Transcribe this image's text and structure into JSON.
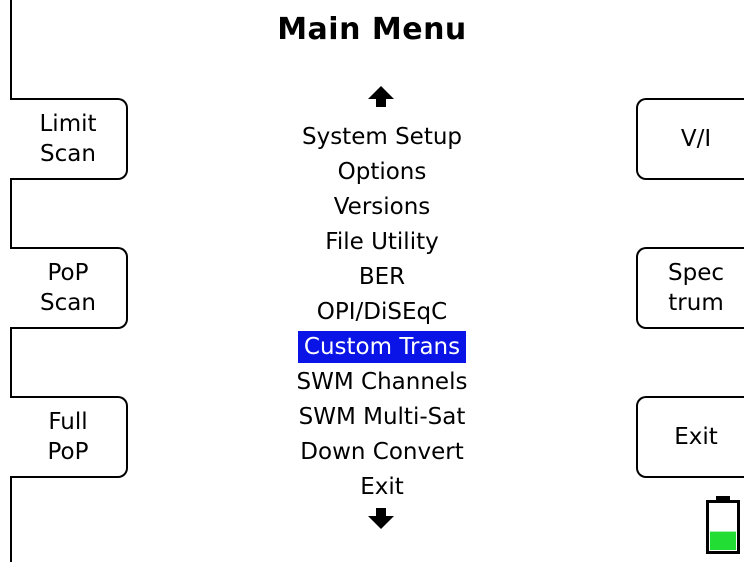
{
  "title": "Main Menu",
  "softkeys": {
    "left": [
      {
        "label": "Limit\nScan"
      },
      {
        "label": "PoP\nScan"
      },
      {
        "label": "Full\nPoP"
      }
    ],
    "right": [
      {
        "label": "V/I"
      },
      {
        "label": "Spec\ntrum"
      },
      {
        "label": "Exit"
      }
    ]
  },
  "menu": {
    "items": [
      "System Setup",
      "Options",
      "Versions",
      "File Utility",
      "BER",
      "OPI/DiSEqC",
      "Custom Trans",
      "SWM Channels",
      "SWM Multi-Sat",
      "Down Convert",
      "Exit"
    ],
    "selected": "Custom Trans",
    "scroll_up_icon": "arrow-up-icon",
    "scroll_down_icon": "arrow-down-icon"
  },
  "battery": {
    "icon": "battery-icon",
    "level": 0.4,
    "fill_color": "#22dd33"
  },
  "colors": {
    "selection_background": "#0a14e6",
    "selection_text": "#ffffff",
    "foreground": "#000000",
    "background": "#ffffff"
  }
}
